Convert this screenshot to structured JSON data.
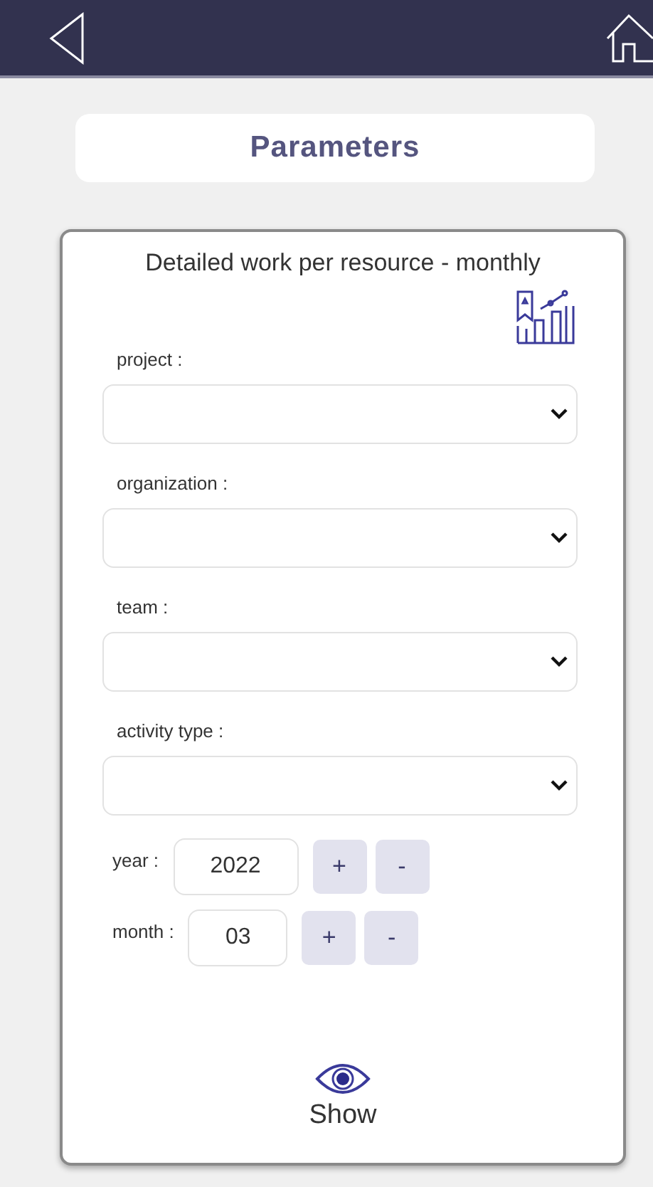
{
  "title": "Parameters",
  "card": {
    "title": "Detailed work per resource - monthly",
    "selects": [
      {
        "label": "project :"
      },
      {
        "label": "organization :"
      },
      {
        "label": "team :"
      },
      {
        "label": "activity type :"
      }
    ],
    "steppers": [
      {
        "label": "year :",
        "value": "2022",
        "plus": "+",
        "minus": "-"
      },
      {
        "label": "month :",
        "value": "03",
        "plus": "+",
        "minus": "-"
      }
    ],
    "action": {
      "label": "Show"
    }
  }
}
